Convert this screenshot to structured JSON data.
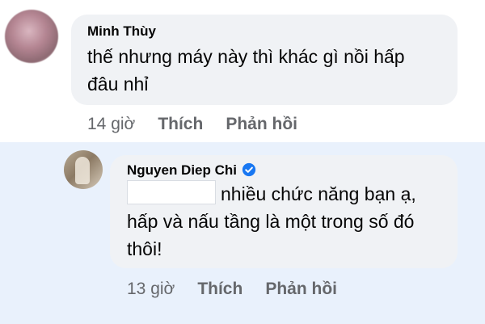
{
  "comments": [
    {
      "author": "Minh Thùy",
      "verified": false,
      "lines": [
        "thế nhưng máy này thì khác gì nồi hấp",
        "đâu nhỉ"
      ],
      "time": "14 giờ",
      "like_label": "Thích",
      "reply_label": "Phản hồi"
    },
    {
      "author": "Nguyen Diep Chi",
      "verified": true,
      "verified_color": "#1877f2",
      "lines": [
        "nhiều chức năng bạn ạ,",
        "hấp và nấu tầng là một trong số đó",
        "thôi!"
      ],
      "time": "13 giờ",
      "like_label": "Thích",
      "reply_label": "Phản hồi"
    }
  ],
  "colors": {
    "bubble": "#f0f2f5",
    "reply_background": "#e9f1fc",
    "meta_text": "#65676b"
  }
}
